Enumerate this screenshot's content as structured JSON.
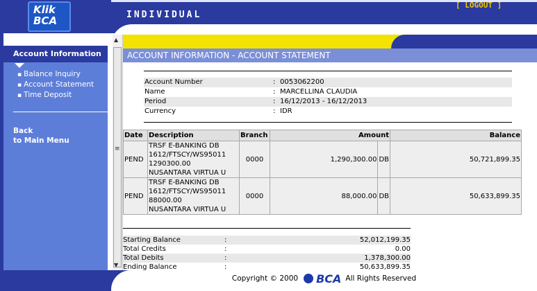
{
  "header": {
    "logo_line1": "Klik",
    "logo_line2": "BCA",
    "title": "INDIVIDUAL",
    "logout": "[ LOGOUT ]"
  },
  "sidebar": {
    "heading": "Account Information",
    "items": [
      {
        "label": "Balance Inquiry"
      },
      {
        "label": "Account Statement"
      },
      {
        "label": "Time Deposit"
      }
    ],
    "back_line1": "Back",
    "back_line2": "to Main Menu"
  },
  "page": {
    "title": "ACCOUNT INFORMATION - ACCOUNT STATEMENT"
  },
  "account_info": [
    {
      "label": "Account Number",
      "colon": ":",
      "value": "0053062200"
    },
    {
      "label": "Name",
      "colon": ":",
      "value": "MARCELLINA CLAUDIA"
    },
    {
      "label": "Period",
      "colon": ":",
      "value": "16/12/2013 - 16/12/2013"
    },
    {
      "label": "Currency",
      "colon": ":",
      "value": "IDR"
    }
  ],
  "table": {
    "headers": {
      "date": "Date",
      "description": "Description",
      "branch": "Branch",
      "amount": "Amount",
      "balance": "Balance"
    },
    "rows": [
      {
        "date": "PEND",
        "description": [
          "TRSF E-BANKING DB",
          "1612/FTSCY/WS95011",
          "1290300.00",
          "NUSANTARA VIRTUA U"
        ],
        "branch": "0000",
        "amount": "1,290,300.00",
        "type": "DB",
        "balance": "50,721,899.35"
      },
      {
        "date": "PEND",
        "description": [
          "TRSF E-BANKING DB",
          "1612/FTSCY/WS95011",
          "88000.00",
          "NUSANTARA VIRTUA U"
        ],
        "branch": "0000",
        "amount": "88,000.00",
        "type": "DB",
        "balance": "50,633,899.35"
      }
    ]
  },
  "summary": [
    {
      "label": "Starting Balance",
      "colon": ":",
      "value": "52,012,199.35"
    },
    {
      "label": "Total Credits",
      "colon": ":",
      "value": "0.00"
    },
    {
      "label": "Total Debits",
      "colon": ":",
      "value": "1,378,300.00"
    },
    {
      "label": "Ending Balance",
      "colon": ":",
      "value": "50,633,899.35"
    }
  ],
  "footer": {
    "copyright": "Copyright © 2000",
    "logo": "BCA",
    "rights": "All Rights Reserved"
  },
  "colors": {
    "navy": "#2a3a9e",
    "sidebar": "#5d7ed8",
    "title_bar": "#7b8fd8",
    "yellow": "#f2e300",
    "logout": "#f2c400"
  }
}
